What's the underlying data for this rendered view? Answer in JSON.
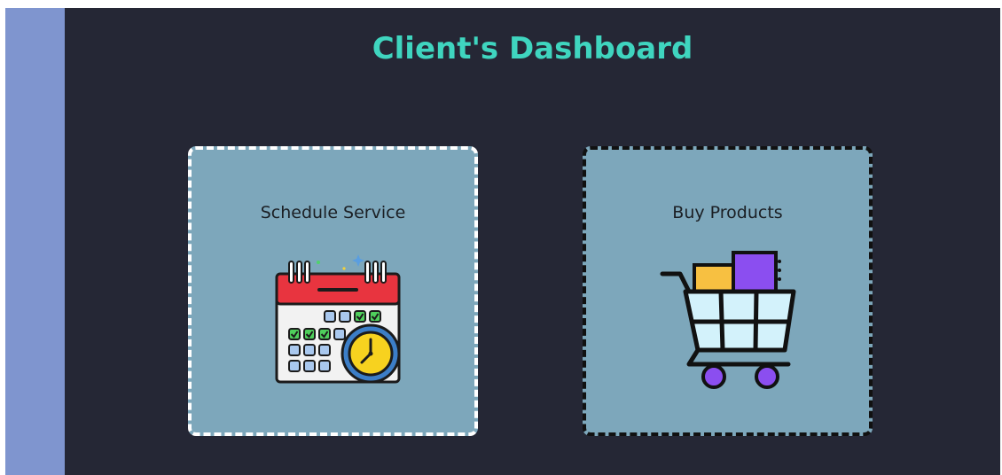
{
  "dashboard": {
    "title": "Client's Dashboard"
  },
  "cards": [
    {
      "label": "Schedule Service",
      "icon": "calendar-clock-icon"
    },
    {
      "label": "Buy Products",
      "icon": "shopping-cart-icon"
    }
  ],
  "colors": {
    "background": "#252735",
    "side_rail": "#7f95cf",
    "title": "#3fd5bf",
    "card": "#7da7bb",
    "schedule_border": "#ffffff",
    "products_border": "#111111"
  }
}
